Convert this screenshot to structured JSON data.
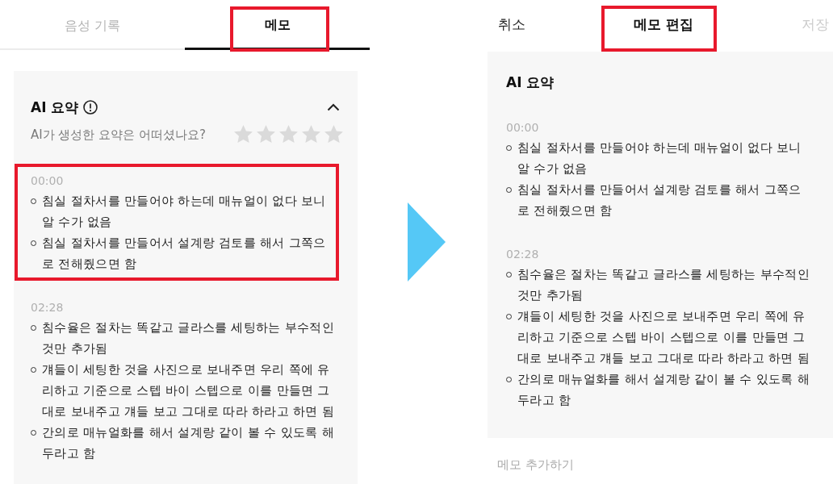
{
  "left_screen": {
    "tabs": [
      {
        "label": "음성 기록",
        "selected": false,
        "highlighted": false
      },
      {
        "label": "메모",
        "selected": true,
        "highlighted": true
      }
    ],
    "summary": {
      "title": "AI 요약",
      "expanded": true,
      "rating_prompt": "AI가 생성한 요약은 어떠셨나요?",
      "stars": 0,
      "sections": [
        {
          "time": "00:00",
          "highlighted": true,
          "bullets": [
            "침실 절차서를 만들어야 하는데 매뉴얼이 없다 보니 알 수가 없음",
            "침실 절차서를 만들어서 설계랑 검토를 해서 그쪽으로 전해줬으면 함"
          ]
        },
        {
          "time": "02:28",
          "highlighted": false,
          "bullets": [
            "침수율은 절차는 똑같고 글라스를 세팅하는 부수적인 것만 추가됨",
            "걔들이 세팅한 것을 사진으로 보내주면 우리 쪽에 유리하고 기준으로 스텝 바이 스텝으로 이를 만들면 그대로 보내주고 걔들 보고 그대로 따라 하라고 하면 됨",
            "간의로 매뉴얼화를 해서 설계랑 같이 볼 수 있도록 해두라고 함"
          ]
        }
      ]
    }
  },
  "right_screen": {
    "header": {
      "cancel": "취소",
      "title": {
        "text": "메모 편집",
        "highlighted": true
      },
      "save": {
        "label": "저장",
        "disabled": true
      }
    },
    "summary": {
      "title": "AI 요약",
      "sections": [
        {
          "time": "00:00",
          "bullets": [
            "침실 절차서를 만들어야 하는데 매뉴얼이 없다 보니 알 수가 없음",
            "침실 절차서를 만들어서 설계랑 검토를 해서 그쪽으로 전해줬으면 함"
          ]
        },
        {
          "time": "02:28",
          "bullets": [
            "침수율은 절차는 똑같고 글라스를 세팅하는 부수적인 것만 추가됨",
            "걔들이 세팅한 것을 사진으로 보내주면 우리 쪽에 유리하고 기준으로 스텝 바이 스텝으로 이를 만들면 그대로 보내주고 걔들 보고 그대로 따라 하라고 하면 됨",
            "간의로 매뉴얼화를 해서 설계랑 같이 볼 수 있도록 해두라고 함"
          ]
        }
      ]
    },
    "memo_input": {
      "placeholder": "메모 추가하기"
    }
  }
}
